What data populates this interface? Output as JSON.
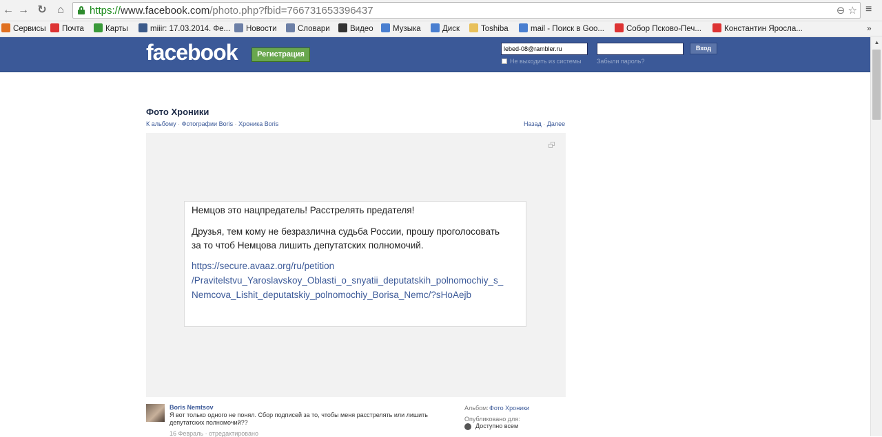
{
  "browser": {
    "url_scheme": "https://",
    "url_host": "www.facebook.com",
    "url_path": "/photo.php?fbid=766731653396437",
    "bookmarks": [
      {
        "label": "Сервисы",
        "icon": "apps-grid-icon",
        "color": "#e07020"
      },
      {
        "label": "Почта",
        "icon": "yandex-mail-icon",
        "color": "#d33"
      },
      {
        "label": "Карты",
        "icon": "maps-icon",
        "color": "#3a9a3a"
      },
      {
        "label": "miiir: 17.03.2014. Фе...",
        "icon": "user-icon",
        "color": "#3b5a8a"
      },
      {
        "label": "Новости",
        "icon": "page-icon",
        "color": "#6c7fa6"
      },
      {
        "label": "Словари",
        "icon": "page-icon",
        "color": "#6c7fa6"
      },
      {
        "label": "Видео",
        "icon": "play-icon",
        "color": "#333"
      },
      {
        "label": "Музыка",
        "icon": "music-icon",
        "color": "#4a7fd0"
      },
      {
        "label": "Диск",
        "icon": "disk-icon",
        "color": "#4a7fd0"
      },
      {
        "label": "Toshiba",
        "icon": "folder-icon",
        "color": "#e8c05a"
      },
      {
        "label": "mail - Поиск в Goo...",
        "icon": "google-icon",
        "color": "#4a7fd0"
      },
      {
        "label": "Собор Псково-Печ...",
        "icon": "yandex-icon",
        "color": "#d33"
      },
      {
        "label": "Константин Яросла...",
        "icon": "yandex-icon",
        "color": "#d33"
      }
    ],
    "more": "»"
  },
  "header": {
    "logo": "facebook",
    "signup_label": "Регистрация",
    "email_value": "lebed-08@rambler.ru",
    "password_value": "",
    "login_label": "Вход",
    "remember_label": "Не выходить из системы",
    "forgot_label": "Забыли пароль?"
  },
  "page": {
    "title": "Фото Хроники",
    "breadcrumb": [
      "К альбому",
      "Фотографии Boris",
      "Хроника Boris"
    ],
    "prev_label": "Назад",
    "next_label": "Далее"
  },
  "note": {
    "line1": "Немцов это нацпредатель! Расстрелять предателя!",
    "line2": "Друзья, тем кому не безразлична судьба России, прошу проголосовать",
    "line3": "за то чтоб Немцова лишить депутатских полномочий.",
    "link1": "https://secure.avaaz.org/ru/petition",
    "link2": "/Pravitelstvu_Yaroslavskoy_Oblasti_o_snyatii_deputatskih_polnomochiy_s_",
    "link3": "Nemcova_Lishit_deputatskiy_polnomochiy_Borisa_Nemc/?sHoAejb"
  },
  "comment": {
    "author": "Boris Nemtsov",
    "text": "Я вот только одного не понял. Сбор подписей за то, чтобы меня расстрелять или лишить депутатских полномочий??",
    "date": "16 Февраль · отредактировано"
  },
  "meta": {
    "album_label": "Альбом:",
    "album_value": "Фото Хроники",
    "published_label": "Опубликовано для:",
    "privacy_value": "Доступно всем"
  }
}
